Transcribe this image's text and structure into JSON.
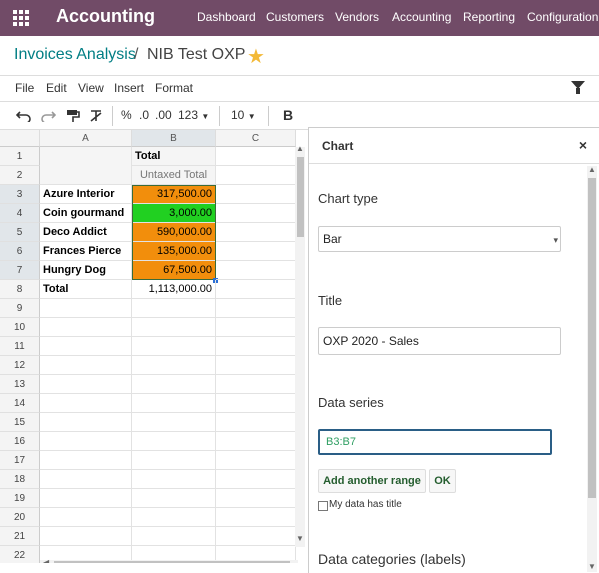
{
  "topbar": {
    "app_title": "Accounting",
    "menu": [
      "Dashboard",
      "Customers",
      "Vendors",
      "Accounting",
      "Reporting",
      "Configuration"
    ]
  },
  "breadcrumb": {
    "parent": "Invoices Analysis",
    "separator": "/",
    "current": "NIB Test OXP"
  },
  "menubar": [
    "File",
    "Edit",
    "View",
    "Insert",
    "Format"
  ],
  "toolbar": {
    "percent": "%",
    "dec_less": ".0",
    "dec_more": ".00",
    "number_format": "123",
    "font_size": "10",
    "bold": "B"
  },
  "sheet": {
    "columns": [
      "A",
      "B",
      "C"
    ],
    "row_numbers": [
      "1",
      "2",
      "3",
      "4",
      "5",
      "6",
      "7",
      "8",
      "9",
      "10",
      "11",
      "12",
      "13",
      "14",
      "15",
      "16",
      "17",
      "18",
      "19",
      "20",
      "21",
      "22"
    ],
    "header_b1": "Total",
    "header_b2": "Untaxed Total",
    "rows": [
      {
        "name": "Azure Interior",
        "value": "317,500.00"
      },
      {
        "name": "Coin gourmand",
        "value": "3,000.00"
      },
      {
        "name": "Deco Addict",
        "value": "590,000.00"
      },
      {
        "name": "Frances Pierce",
        "value": "135,000.00"
      },
      {
        "name": "Hungry Dog",
        "value": "67,500.00"
      }
    ],
    "total_label": "Total",
    "total_value": "1,113,000.00",
    "colors": {
      "orange": "#f28e0c",
      "green": "#21d021"
    }
  },
  "panel": {
    "title": "Chart",
    "close": "×",
    "chart_type_label": "Chart type",
    "chart_type_value": "Bar",
    "title_label": "Title",
    "title_value": "OXP 2020 - Sales",
    "data_series_label": "Data series",
    "data_series_value": "B3:B7",
    "add_range_button": "Add another range",
    "ok_button": "OK",
    "has_title_label": "My data has title",
    "categories_label": "Data categories (labels)"
  },
  "theme": {
    "primary": "#714b67",
    "link": "#017e84",
    "star": "#f3b937"
  }
}
